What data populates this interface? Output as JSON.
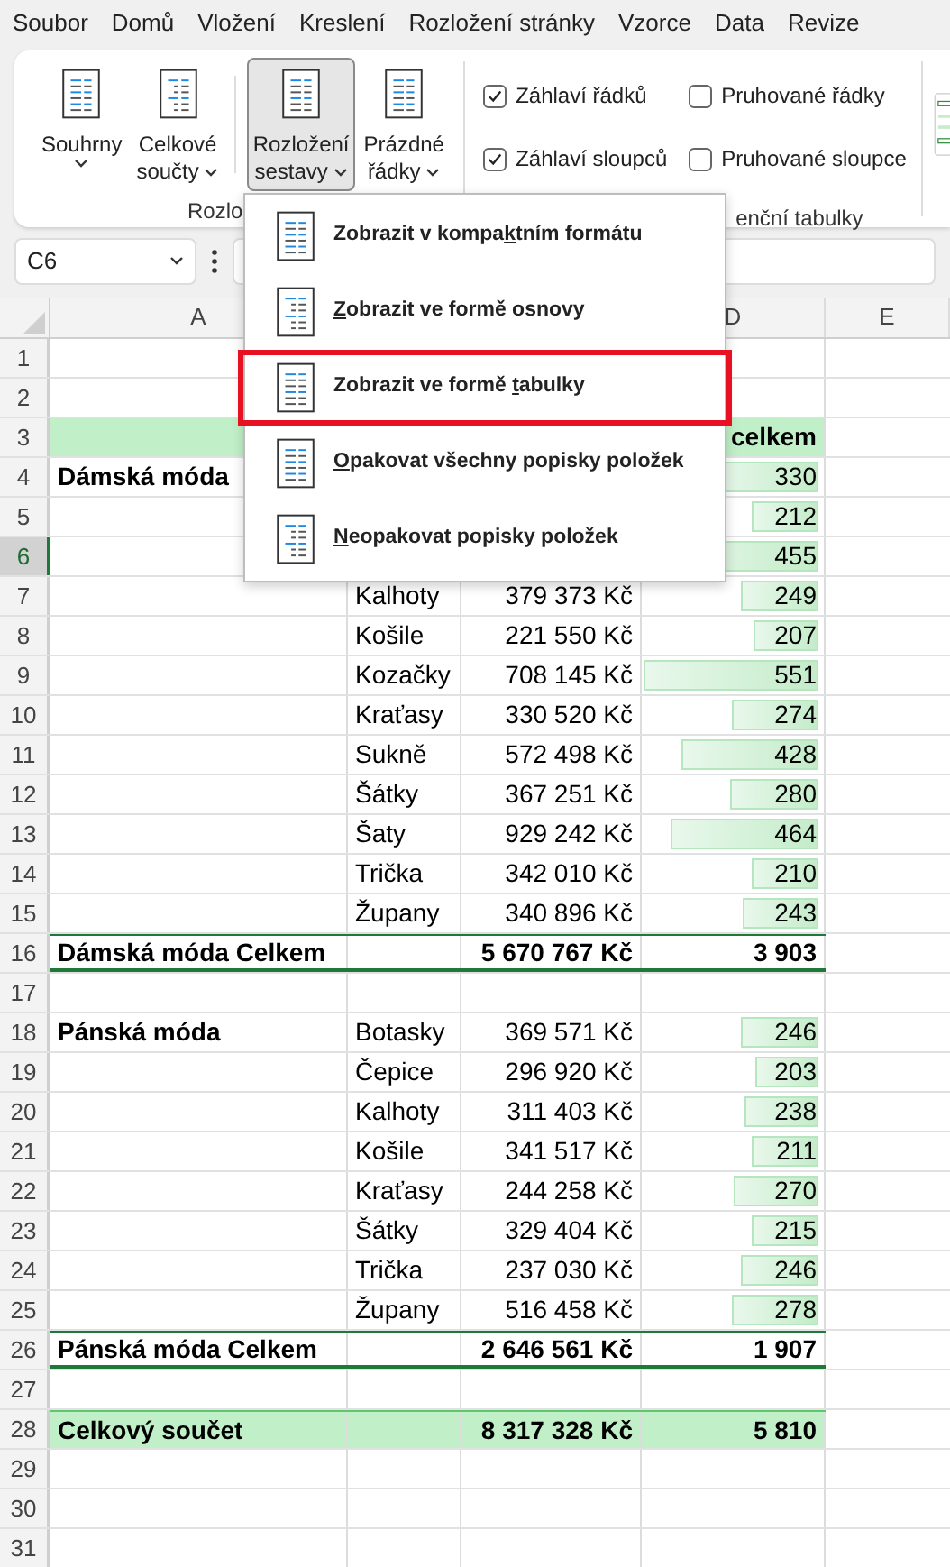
{
  "menu_tabs": [
    {
      "label": "Soubor"
    },
    {
      "label": "Domů"
    },
    {
      "label": "Vložení"
    },
    {
      "label": "Kreslení"
    },
    {
      "label": "Rozložení stránky"
    },
    {
      "label": "Vzorce"
    },
    {
      "label": "Data"
    },
    {
      "label": "Revize"
    }
  ],
  "ribbon": {
    "button_groups": [
      [
        {
          "lines": [
            "Souhrny"
          ],
          "pressed": false
        },
        {
          "lines": [
            "Celkové",
            "součty"
          ],
          "pressed": false
        }
      ],
      [
        {
          "lines": [
            "Rozložení",
            "sestavy"
          ],
          "pressed": true
        },
        {
          "lines": [
            "Prázdné",
            "řádky"
          ],
          "pressed": false
        }
      ]
    ],
    "group_label_1": "Rozlo",
    "checkboxes": [
      {
        "label": "Záhlaví řádků",
        "checked": true
      },
      {
        "label": "Pruhované řádky",
        "checked": false
      },
      {
        "label": "Záhlaví sloupců",
        "checked": true
      },
      {
        "label": "Pruhované sloupce",
        "checked": false
      }
    ],
    "group_label_2": "enční tabulky"
  },
  "name_box": "C6",
  "columns": [
    {
      "label": "A"
    },
    {},
    {},
    {
      "label": "D"
    },
    {
      "label": "E"
    }
  ],
  "rows": [
    {
      "num": "1",
      "selected": false,
      "kind": "blank"
    },
    {
      "num": "2",
      "selected": false,
      "kind": "blank"
    },
    {
      "num": "3",
      "selected": false,
      "kind": "header",
      "d": "celkem"
    },
    {
      "num": "4",
      "selected": false,
      "kind": "item",
      "a": "Dámská móda",
      "d": "330",
      "level": 0.57
    },
    {
      "num": "5",
      "selected": false,
      "kind": "item",
      "d": "212",
      "level": 0.37
    },
    {
      "num": "6",
      "selected": true,
      "kind": "item",
      "d": "455",
      "level": 0.79
    },
    {
      "num": "7",
      "selected": false,
      "kind": "item",
      "b": "Kalhoty",
      "c": "379 373 Kč",
      "d": "249",
      "level": 0.43
    },
    {
      "num": "8",
      "selected": false,
      "kind": "item",
      "b": "Košile",
      "c": "221 550 Kč",
      "d": "207",
      "level": 0.36
    },
    {
      "num": "9",
      "selected": false,
      "kind": "item",
      "b": "Kozačky",
      "c": "708 145 Kč",
      "d": "551",
      "level": 0.96
    },
    {
      "num": "10",
      "selected": false,
      "kind": "item",
      "b": "Kraťasy",
      "c": "330 520 Kč",
      "d": "274",
      "level": 0.48
    },
    {
      "num": "11",
      "selected": false,
      "kind": "item",
      "b": "Sukně",
      "c": "572 498 Kč",
      "d": "428",
      "level": 0.75
    },
    {
      "num": "12",
      "selected": false,
      "kind": "item",
      "b": "Šátky",
      "c": "367 251 Kč",
      "d": "280",
      "level": 0.49
    },
    {
      "num": "13",
      "selected": false,
      "kind": "item",
      "b": "Šaty",
      "c": "929 242 Kč",
      "d": "464",
      "level": 0.81
    },
    {
      "num": "14",
      "selected": false,
      "kind": "item",
      "b": "Trička",
      "c": "342 010 Kč",
      "d": "210",
      "level": 0.37
    },
    {
      "num": "15",
      "selected": false,
      "kind": "item",
      "b": "Župany",
      "c": "340 896 Kč",
      "d": "243",
      "level": 0.42
    },
    {
      "num": "16",
      "selected": false,
      "kind": "subtotal",
      "a": "Dámská móda Celkem",
      "c": "5 670 767 Kč",
      "d": "3 903"
    },
    {
      "num": "17",
      "selected": false,
      "kind": "blank"
    },
    {
      "num": "18",
      "selected": false,
      "kind": "item",
      "a": "Pánská móda",
      "b": "Botasky",
      "c": "369 571 Kč",
      "d": "246",
      "level": 0.43
    },
    {
      "num": "19",
      "selected": false,
      "kind": "item",
      "b": "Čepice",
      "c": "296 920 Kč",
      "d": "203",
      "level": 0.35
    },
    {
      "num": "20",
      "selected": false,
      "kind": "item",
      "b": "Kalhoty",
      "c": "311 403 Kč",
      "d": "238",
      "level": 0.41
    },
    {
      "num": "21",
      "selected": false,
      "kind": "item",
      "b": "Košile",
      "c": "341 517 Kč",
      "d": "211",
      "level": 0.37
    },
    {
      "num": "22",
      "selected": false,
      "kind": "item",
      "b": "Kraťasy",
      "c": "244 258 Kč",
      "d": "270",
      "level": 0.47
    },
    {
      "num": "23",
      "selected": false,
      "kind": "item",
      "b": "Šátky",
      "c": "329 404 Kč",
      "d": "215",
      "level": 0.37
    },
    {
      "num": "24",
      "selected": false,
      "kind": "item",
      "b": "Trička",
      "c": "237 030 Kč",
      "d": "246",
      "level": 0.43
    },
    {
      "num": "25",
      "selected": false,
      "kind": "item",
      "b": "Župany",
      "c": "516 458 Kč",
      "d": "278",
      "level": 0.48
    },
    {
      "num": "26",
      "selected": false,
      "kind": "subtotal",
      "a": "Pánská móda Celkem",
      "c": "2 646 561 Kč",
      "d": "1 907"
    },
    {
      "num": "27",
      "selected": false,
      "kind": "blank"
    },
    {
      "num": "28",
      "selected": false,
      "kind": "grand",
      "a": "Celkový součet",
      "c": "8 317 328 Kč",
      "d": "5 810"
    },
    {
      "num": "29",
      "selected": false,
      "kind": "blank"
    },
    {
      "num": "30",
      "selected": false,
      "kind": "blank"
    },
    {
      "num": "31",
      "selected": false,
      "kind": "blank"
    }
  ],
  "dropdown": [
    {
      "before": "Zobrazit v kompa",
      "key": "k",
      "after": "tním formátu",
      "highlighted": false
    },
    {
      "key": "Z",
      "after": "obrazit ve formě osnovy",
      "highlighted": false
    },
    {
      "before": "Zobrazit ve formě ",
      "key": "t",
      "after": "abulky",
      "highlighted": true
    },
    {
      "key": "O",
      "after": "pakovat všechny popisky položek",
      "highlighted": false
    },
    {
      "key": "N",
      "after": "eopakovat popisky položek",
      "highlighted": false
    }
  ]
}
